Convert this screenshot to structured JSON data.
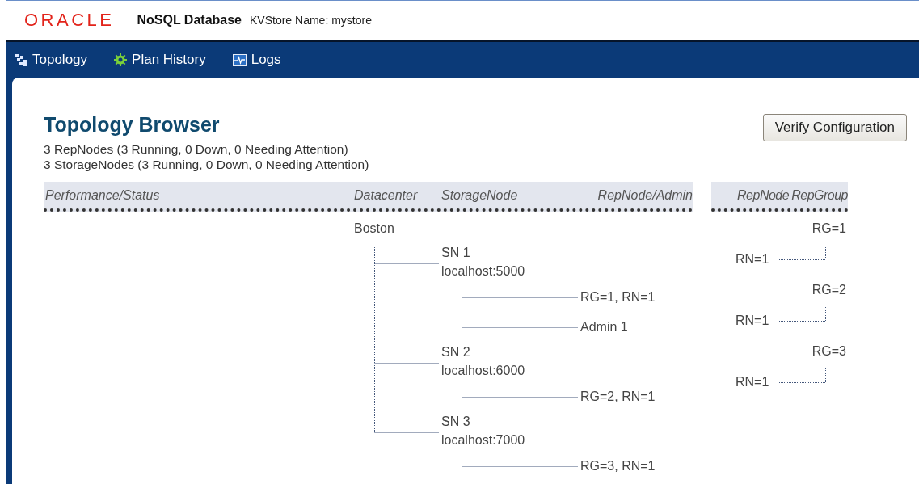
{
  "header": {
    "logo": "ORACLE",
    "product": "NoSQL Database",
    "store": "KVStore Name: mystore"
  },
  "nav": [
    {
      "label": "Topology",
      "kind": "topology"
    },
    {
      "label": "Plan History",
      "kind": "plan"
    },
    {
      "label": "Logs",
      "kind": "logs"
    }
  ],
  "page": {
    "title": "Topology Browser",
    "stats": [
      "3 RepNodes (3 Running, 0 Down, 0 Needing Attention)",
      "3 StorageNodes (3 Running, 0 Down, 0 Needing Attention)"
    ],
    "button": "Verify Configuration"
  },
  "columns": {
    "left": [
      "Performance/Status",
      "Datacenter",
      "StorageNode",
      "RepNode/Admin"
    ],
    "right": [
      "RepNode",
      "RepGroup"
    ]
  },
  "datacenters": [
    {
      "name": "Boston",
      "children": [
        {
          "name": "SN 1",
          "host": "localhost:5000",
          "children": [
            {
              "label": "RG=1, RN=1"
            },
            {
              "label": "Admin 1"
            }
          ]
        },
        {
          "name": "SN 2",
          "host": "localhost:6000",
          "children": [
            {
              "label": "RG=2, RN=1"
            }
          ]
        },
        {
          "name": "SN 3",
          "host": "localhost:7000",
          "children": [
            {
              "label": "RG=3, RN=1"
            }
          ]
        }
      ]
    }
  ],
  "repgroups": [
    {
      "group": "RG=1",
      "children": [
        {
          "label": "RN=1"
        }
      ]
    },
    {
      "group": "RG=2",
      "children": [
        {
          "label": "RN=1"
        }
      ]
    },
    {
      "group": "RG=3",
      "children": [
        {
          "label": "RN=1"
        }
      ]
    }
  ]
}
